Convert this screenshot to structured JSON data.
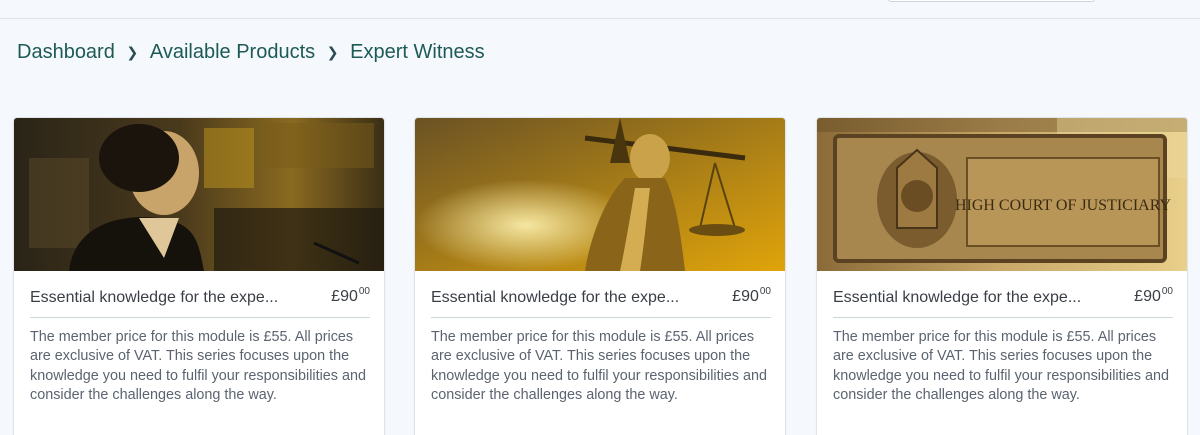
{
  "breadcrumb": {
    "items": [
      "Dashboard",
      "Available Products",
      "Expert Witness"
    ]
  },
  "products": [
    {
      "image": "woman-witness-photo",
      "title": "Essential knowledge for the expe...",
      "price_main": "£90",
      "price_cents": "00",
      "description": "The member price for this module is £55. All prices are exclusive of VAT. This series focuses upon the knowledge you need to fulfil your responsibilities and consider the challenges along the way."
    },
    {
      "image": "lady-justice-photo",
      "title": "Essential knowledge for the expe...",
      "price_main": "£90",
      "price_cents": "00",
      "description": "The member price for this module is £55. All prices are exclusive of VAT. This series focuses upon the knowledge you need to fulfil your responsibilities and consider the challenges along the way."
    },
    {
      "image": "high-court-sign-photo",
      "title": "Essential knowledge for the expe...",
      "price_main": "£90",
      "price_cents": "00",
      "description": "The member price for this module is £55. All prices are exclusive of VAT. This series focuses upon the knowledge you need to fulfil your responsibilities and consider the challenges along the way.",
      "image_text": "HIGH COURT OF JUSTICIARY"
    }
  ],
  "colors": {
    "breadcrumb": "#1d5a55",
    "page_background": "#f5f8fc",
    "card_divider": "#c9d8d6",
    "image_tint": "#c9961a"
  }
}
